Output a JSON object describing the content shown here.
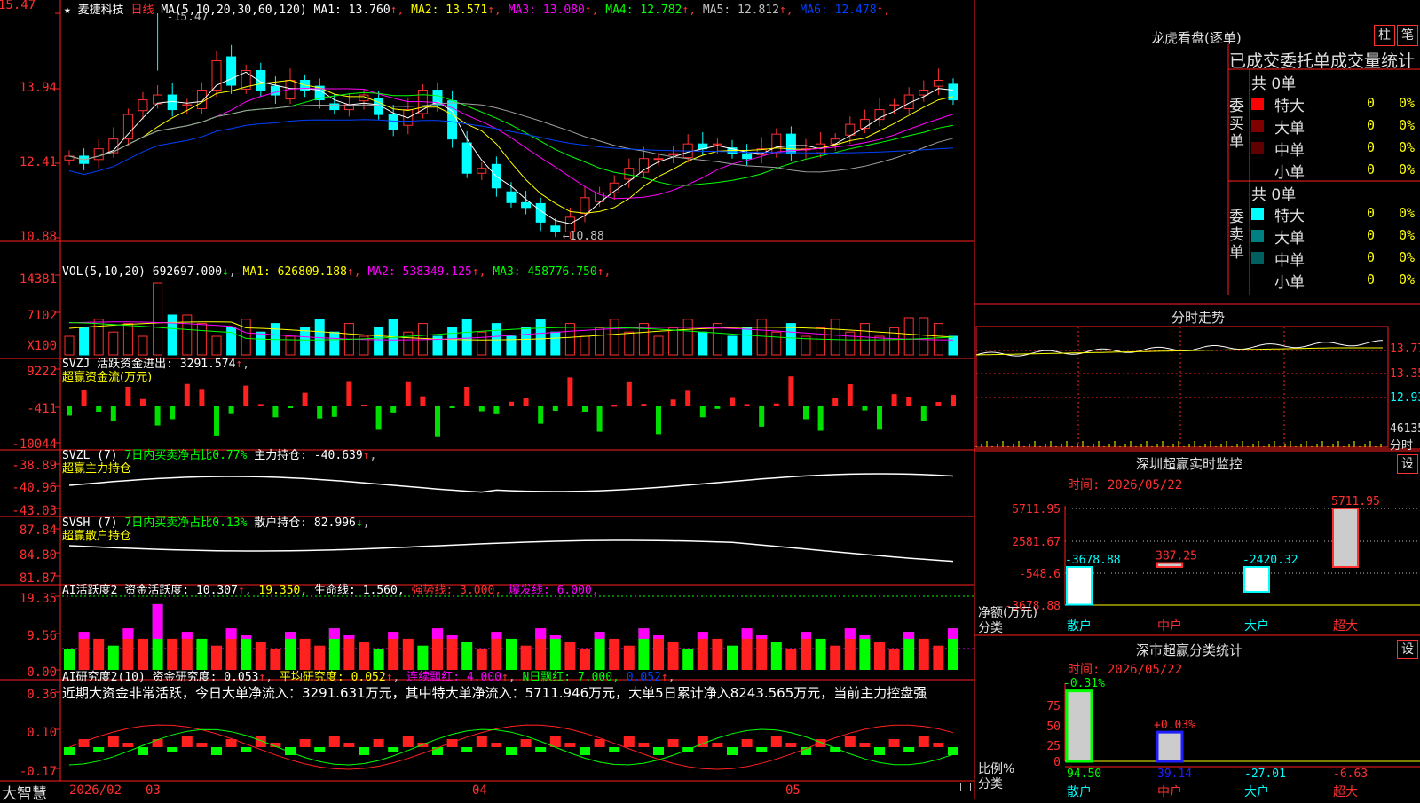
{
  "main": {
    "star": "★",
    "stock_name": "麦捷科技",
    "period": "日线",
    "ma_params": "MA(5,10,20,30,60,120)",
    "ma_values": [
      {
        "label": "MA1:",
        "value": "13.760",
        "arrow": "↑",
        "color": "#ffffff"
      },
      {
        "label": "MA2:",
        "value": "13.571",
        "arrow": "↑",
        "color": "#ffff00"
      },
      {
        "label": "MA3:",
        "value": "13.080",
        "arrow": "↑",
        "color": "#ff00ff"
      },
      {
        "label": "MA4:",
        "value": "12.782",
        "arrow": "↑",
        "color": "#00ff00"
      },
      {
        "label": "MA5:",
        "value": "12.812",
        "arrow": "↑",
        "color": "#c0c0c0"
      },
      {
        "label": "MA6:",
        "value": "12.478",
        "arrow": "↑",
        "color": "#0040ff"
      }
    ],
    "y_ticks": [
      "15.47",
      "13.94",
      "12.41",
      "10.88"
    ],
    "high_label": "15.47",
    "low_label": "10.88",
    "colors": {
      "up": "#ff3030",
      "down": "#00ffff",
      "ma1": "#ffffff",
      "ma2": "#ffff00",
      "ma3": "#ff00ff",
      "ma4": "#00ff00",
      "ma5": "#a0a0a0",
      "ma6": "#0040ff"
    }
  },
  "vol": {
    "header": "VOL(5,10,20)",
    "value": "692697.000",
    "arrow": "↓",
    "items": [
      {
        "label": "MA1:",
        "value": "626809.188",
        "arrow": "↑",
        "color": "#ffff00"
      },
      {
        "label": "MA2:",
        "value": "538349.125",
        "arrow": "↑",
        "color": "#ff00ff"
      },
      {
        "label": "MA3:",
        "value": "458776.750",
        "arrow": "↑",
        "color": "#00ff00"
      }
    ],
    "y_ticks": [
      "14381",
      "7102"
    ],
    "unit": "X100"
  },
  "svzj": {
    "header": "SVZJ",
    "title": "活跃资金进出:",
    "value": "3291.574",
    "arrow": "↑",
    "subtitle": "超赢资金流(万元)",
    "y_ticks": [
      "9222",
      "-411",
      "-10044"
    ]
  },
  "svzl": {
    "header": "SVZL (7)",
    "green_text": "7日内买卖净占比0.77%",
    "label": "主力持仓:",
    "value": "-40.639",
    "arrow": "↑",
    "subtitle": "超赢主力持仓",
    "y_ticks": [
      "-38.89",
      "-40.96",
      "-43.03"
    ]
  },
  "svsh": {
    "header": "SVSH (7)",
    "green_text": "7日内买卖净占比0.13%",
    "label": "散户持仓:",
    "value": "82.996",
    "arrow": "↓",
    "subtitle": "超赢散户持仓",
    "y_ticks": [
      "87.84",
      "84.80",
      "81.87"
    ]
  },
  "ai1": {
    "header": "AI活跃度2",
    "label": "资金活跃度:",
    "value1": "10.307",
    "value2": "19.350,",
    "life_label": "生命线:",
    "life_value": "1.560,",
    "strong": "强势线: 3.000,",
    "burst": "爆发线: 6.000,",
    "y_ticks": [
      "19.35",
      "9.56",
      "0.00"
    ]
  },
  "ai2": {
    "header": "AI研究度2(10)",
    "label": "资金研究度:",
    "value": "0.053",
    "avg_label": "平均研究度:",
    "avg_value": "0.052",
    "red_label": "连续飘红:",
    "red_value": "4.000",
    "nred_label": "N日飘红:",
    "nred_value": "7.000,",
    "last": "0.052",
    "summary": "近期大资金非常活跃，今日大单净流入：3291.631万元，其中特大单净流入：5711.946万元，大单5日累计净入8243.565万元，当前主力控盘强",
    "y_ticks": [
      "0.36",
      "0.10",
      "-0.17"
    ]
  },
  "xaxis": {
    "app": "大智慧",
    "labels": [
      "2026/02",
      "03",
      "04",
      "05"
    ]
  },
  "right": {
    "top_title": "龙虎看盘(逐单)",
    "btn1": "柱",
    "btn2": "笔",
    "header": "已成交委托单成交量统计",
    "buy_label": "委买单",
    "sell_label": "委卖单",
    "buy_total": "共 0单",
    "sell_total": "共 0单",
    "buy_rows": [
      {
        "name": "特大",
        "count": "0",
        "pct": "0%",
        "color": "#ff0000"
      },
      {
        "name": "大单",
        "count": "0",
        "pct": "0%",
        "color": "#800000"
      },
      {
        "name": "中单",
        "count": "0",
        "pct": "0%",
        "color": "#600000"
      },
      {
        "name": "小单",
        "count": "0",
        "pct": "0%",
        "color": "#000000"
      }
    ],
    "sell_rows": [
      {
        "name": "特大",
        "count": "0",
        "pct": "0%",
        "color": "#00ffff"
      },
      {
        "name": "大单",
        "count": "0",
        "pct": "0%",
        "color": "#008080"
      },
      {
        "name": "中单",
        "count": "0",
        "pct": "0%",
        "color": "#006060"
      },
      {
        "name": "小单",
        "count": "0",
        "pct": "0%",
        "color": "#000000"
      }
    ],
    "intraday_title": "分时走势",
    "intraday_ticks": [
      "13.77",
      "13.35",
      "12.93",
      "46135"
    ],
    "intraday_unit": "分时",
    "monitor_title": "深圳超赢实时监控",
    "set": "设",
    "monitor_time": "时间: 2026/05/22",
    "monitor_ticks": [
      "5711.95",
      "2581.67",
      "-548.6",
      "-3678.88"
    ],
    "monitor_ylabel": "净额(万元)",
    "monitor_xlabel": "分类",
    "monitor_bars": [
      {
        "cat": "散户",
        "value": "-3678.88"
      },
      {
        "cat": "中户",
        "value": "387.25"
      },
      {
        "cat": "大户",
        "value": "-2420.32"
      },
      {
        "cat": "超大",
        "value": "5711.95"
      }
    ],
    "stats_title": "深市超赢分类统计",
    "stats_time": "时间: 2026/05/22",
    "stats_ticks": [
      "75",
      "50",
      "25",
      "0"
    ],
    "stats_ylabel": "比例%",
    "stats_xlabel": "分类",
    "stats_top1": "-0.31%",
    "stats_top2": "+0.03%",
    "stats_bars": [
      {
        "cat": "散户",
        "value": "94.50"
      },
      {
        "cat": "中户",
        "value": "39.14"
      },
      {
        "cat": "大户",
        "value": "-27.01"
      },
      {
        "cat": "超大",
        "value": "-6.63"
      }
    ]
  }
}
